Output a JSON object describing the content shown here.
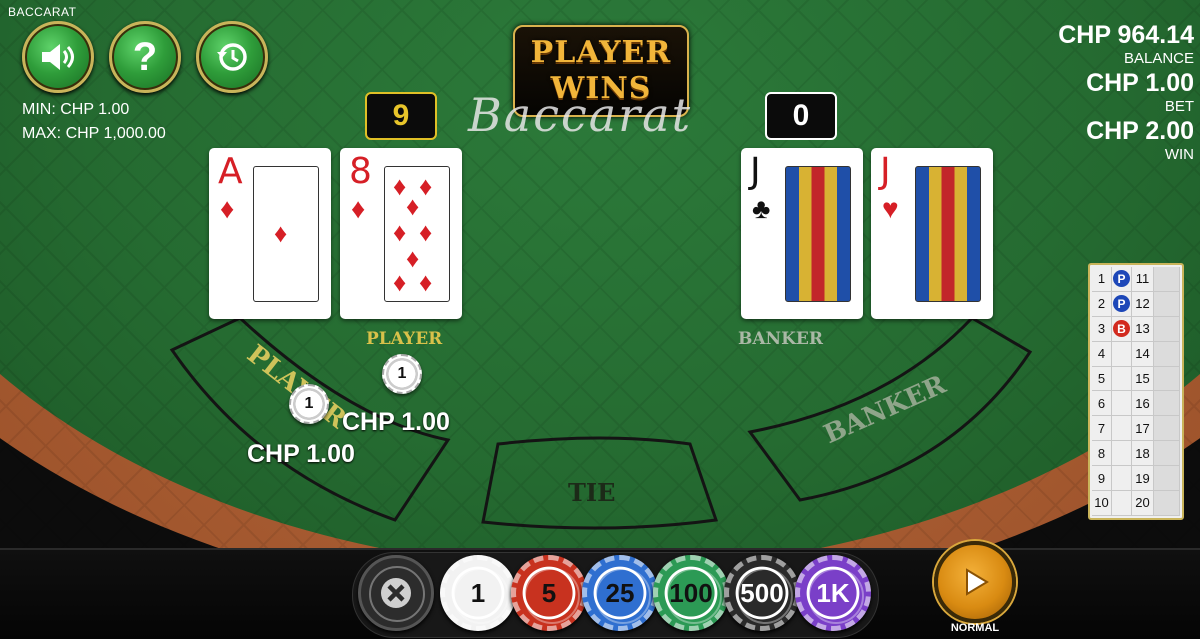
{
  "game_title": "BACCARAT",
  "limits": {
    "min": "MIN:  CHP 1.00",
    "max": "MAX: CHP 1,000.00"
  },
  "result_banner": {
    "line1": "PLAYER",
    "line2": "WINS"
  },
  "table_logo": "Baccarat",
  "player": {
    "score": "9",
    "label": "PLAYER",
    "cards": [
      {
        "rank": "A",
        "suit": "♦",
        "color": "red"
      },
      {
        "rank": "8",
        "suit": "♦",
        "color": "red"
      }
    ]
  },
  "banker": {
    "score": "0",
    "label": "BANKER",
    "cards": [
      {
        "rank": "J",
        "suit": "♣",
        "color": "black"
      },
      {
        "rank": "J",
        "suit": "♥",
        "color": "red"
      }
    ]
  },
  "zones": {
    "player": "PLAYER",
    "tie": "TIE",
    "banker": "BANKER"
  },
  "bets": {
    "chip_value": "1",
    "player_bet": "CHP 1.00",
    "player_win": "CHP 1.00"
  },
  "stats": {
    "balance_value": "CHP 964.14",
    "balance_label": "BALANCE",
    "bet_value": "CHP 1.00",
    "bet_label": "BET",
    "win_value": "CHP 2.00",
    "win_label": "WIN"
  },
  "history_road": {
    "rows": [
      {
        "n1": "1",
        "r1": "P",
        "n2": "11"
      },
      {
        "n1": "2",
        "r1": "P",
        "n2": "12"
      },
      {
        "n1": "3",
        "r1": "B",
        "n2": "13"
      },
      {
        "n1": "4",
        "r1": "",
        "n2": "14"
      },
      {
        "n1": "5",
        "r1": "",
        "n2": "15"
      },
      {
        "n1": "6",
        "r1": "",
        "n2": "16"
      },
      {
        "n1": "7",
        "r1": "",
        "n2": "17"
      },
      {
        "n1": "8",
        "r1": "",
        "n2": "18"
      },
      {
        "n1": "9",
        "r1": "",
        "n2": "19"
      },
      {
        "n1": "10",
        "r1": "",
        "n2": "20"
      }
    ],
    "colors": {
      "P": "#1d47b8",
      "B": "#d22a1f"
    }
  },
  "chips": [
    {
      "label": "1",
      "color": "#f2f2f2",
      "text": "#111"
    },
    {
      "label": "5",
      "color": "#c8321f",
      "text": "#111"
    },
    {
      "label": "25",
      "color": "#2f6fd0",
      "text": "#111"
    },
    {
      "label": "100",
      "color": "#2c9a55",
      "text": "#111"
    },
    {
      "label": "500",
      "color": "#2a2a2a",
      "text": "#fff"
    },
    {
      "label": "1K",
      "color": "#7a3fc8",
      "text": "#fff"
    }
  ],
  "speed_label": "NORMAL",
  "icons": {
    "sound": "speaker-icon",
    "help": "question-icon",
    "history": "history-clock-icon",
    "clear": "close-icon",
    "play": "play-icon"
  }
}
